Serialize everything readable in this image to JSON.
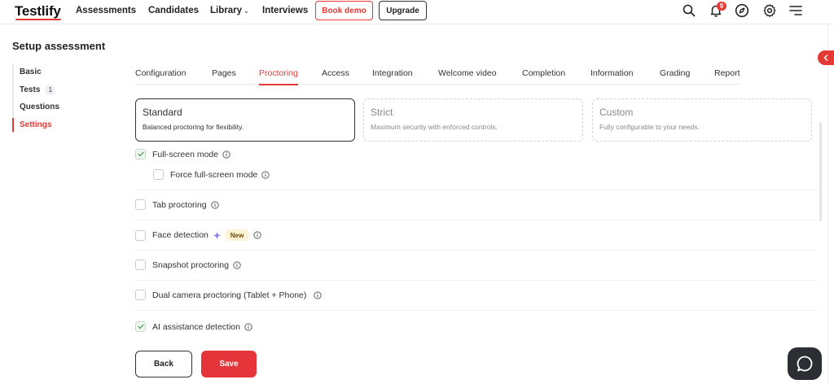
{
  "app": {
    "logo_text": "Testlify",
    "brand_color": "#e53935"
  },
  "topnav": {
    "items": [
      "Assessments",
      "Candidates",
      "Library",
      "Interviews"
    ],
    "library_chevron": "⌄",
    "book_demo_label": "Book demo",
    "upgrade_label": "Upgrade",
    "notification_count": "9",
    "icons": [
      "search-icon",
      "bell-icon",
      "compass-icon",
      "gear-icon",
      "menu-icon"
    ]
  },
  "page": {
    "title": "Setup assessment"
  },
  "sidebar": {
    "items": [
      {
        "label": "Basic"
      },
      {
        "label": "Tests",
        "count": "1"
      },
      {
        "label": "Questions"
      },
      {
        "label": "Settings",
        "active": true
      }
    ]
  },
  "tabs": {
    "items": [
      "Configuration",
      "Pages",
      "Proctoring",
      "Access",
      "Integration",
      "Welcome video",
      "Completion",
      "Information",
      "Grading",
      "Report"
    ],
    "active": "Proctoring"
  },
  "presets": [
    {
      "title": "Standard",
      "desc": "Balanced proctoring for flexibility.",
      "selected": true
    },
    {
      "title": "Strict",
      "desc": "Maximum security with enforced controls.",
      "selected": false
    },
    {
      "title": "Custom",
      "desc": "Fully configurable to your needs.",
      "selected": false
    }
  ],
  "options": {
    "fullscreen": {
      "label": "Full-screen mode",
      "checked": true
    },
    "force_fullscreen": {
      "label": "Force full-screen mode",
      "checked": false
    },
    "tab_proctoring": {
      "label": "Tab proctoring",
      "checked": false
    },
    "face_detection": {
      "label": "Face detection",
      "checked": false,
      "badge": "New"
    },
    "snapshot": {
      "label": "Snapshot proctoring",
      "checked": false
    },
    "dual_camera": {
      "label": "Dual camera proctoring (Tablet + Phone)",
      "checked": false
    },
    "ai_detection": {
      "label": "AI assistance detection",
      "checked": true
    }
  },
  "footer": {
    "back_label": "Back",
    "save_label": "Save"
  }
}
